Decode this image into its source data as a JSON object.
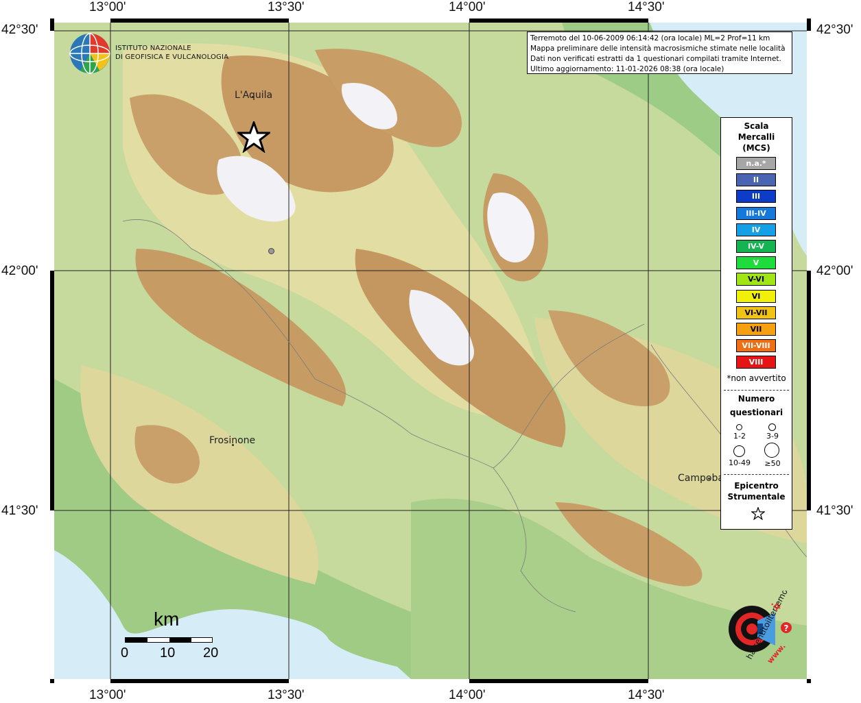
{
  "axes": {
    "top_lon": [
      "13°00'",
      "13°30'",
      "14°00'",
      "14°30'"
    ],
    "bottom_lon": [
      "13°00'",
      "13°30'",
      "14°00'",
      "14°30'"
    ],
    "left_lat": [
      "42°30'",
      "42°00'",
      "41°30'"
    ],
    "right_lat": [
      "42°30'",
      "42°00'",
      "41°30'"
    ]
  },
  "logo": {
    "line1": "ISTITUTO NAZIONALE",
    "line2": "DI GEOFISICA E VULCANOLOGIA"
  },
  "info": {
    "line1": "Terremoto del 10-06-2009 06:14:42 (ora locale) ML=2 Prof=11 km",
    "line2": "Mappa preliminare delle intensità macrosismiche stimate nelle località",
    "line3": "Dati non verificati estratti da 1 questionari compilati tramite Internet.",
    "line4": "Ultimo aggiornamento: 11-01-2026 08:38 (ora locale)"
  },
  "cities": {
    "laquila": "L'Aquila",
    "frosinone": "Frosinone",
    "campobasso": "Campoba"
  },
  "legend": {
    "title1": "Scala",
    "title2": "Mercalli",
    "title3": "(MCS)",
    "scale": [
      {
        "label": "n.a.*",
        "color": "#a6a6a6"
      },
      {
        "label": "II",
        "color": "#4a64b4"
      },
      {
        "label": "III",
        "color": "#0c3cc8"
      },
      {
        "label": "III-IV",
        "color": "#1478dc"
      },
      {
        "label": "IV",
        "color": "#14a0e6"
      },
      {
        "label": "IV-V",
        "color": "#14b450"
      },
      {
        "label": "V",
        "color": "#1edc3c"
      },
      {
        "label": "V-VI",
        "color": "#a0e614"
      },
      {
        "label": "VI",
        "color": "#f0f00a"
      },
      {
        "label": "VI-VII",
        "color": "#f0c314"
      },
      {
        "label": "VII",
        "color": "#f5a00f"
      },
      {
        "label": "VII-VIII",
        "color": "#f06e14"
      },
      {
        "label": "VIII",
        "color": "#e61414"
      }
    ],
    "na_note": "*non avvertito",
    "questionnaires_title1": "Numero",
    "questionnaires_title2": "questionari",
    "q_1_2": "1-2",
    "q_3_9": "3-9",
    "q_10_49": "10-49",
    "q_50": "≥50",
    "epicenter_title1": "Epicentro",
    "epicenter_title2": "Strumentale"
  },
  "scalebar": {
    "unit": "km",
    "labels": [
      "0",
      "10",
      "20"
    ]
  },
  "hsit_logo": {
    "text1": "haisentitoilterremoto",
    "text2": ".it",
    "text3": "www.",
    "question": "?"
  },
  "colors": {
    "sea": "#d6ecf6",
    "lowland": "#b7d597",
    "hills": "#e0dfa2",
    "mountain": "#c9a26a",
    "peak": "#f4f4f8"
  }
}
